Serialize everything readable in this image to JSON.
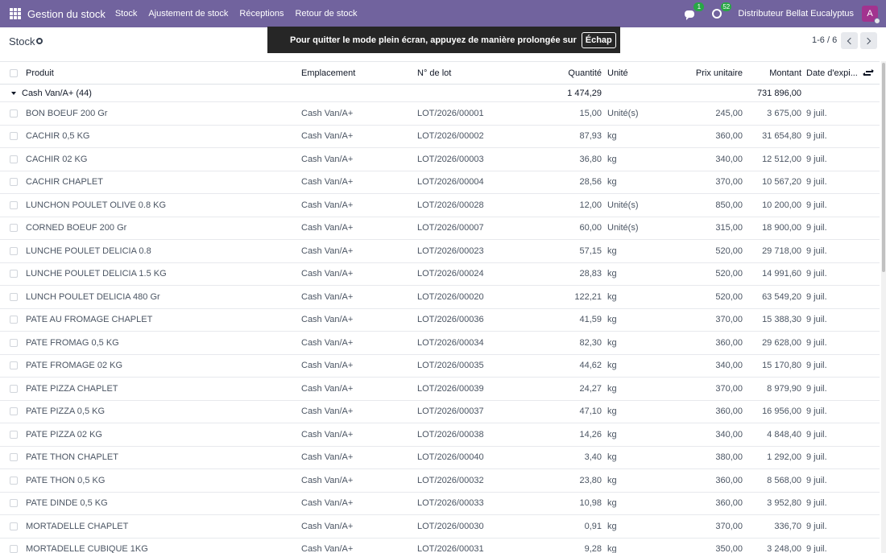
{
  "navbar": {
    "app_title": "Gestion du stock",
    "menu": [
      "Stock",
      "Ajustement de stock",
      "Réceptions",
      "Retour de stock"
    ],
    "messages_badge": "1",
    "activities_badge": "52",
    "company": "Distributeur Bellat Eucalyptus",
    "avatar_letter": "A",
    "colors": {
      "navbar_bg": "#71639e",
      "avatar_bg": "#a2338f",
      "badge_bg": "#28a745"
    }
  },
  "control_panel": {
    "breadcrumb": "Stock",
    "pager_value": "1-6 / 6"
  },
  "fullscreen_notice": {
    "text": "Pour quitter le mode plein écran, appuyez de manière prolongée sur",
    "key": "Échap"
  },
  "table": {
    "columns": {
      "product": "Produit",
      "location": "Emplacement",
      "lot": "N° de lot",
      "quantity": "Quantité",
      "uom": "Unité",
      "unit_price": "Prix unitaire",
      "amount": "Montant",
      "expiry": "Date d'expi..."
    },
    "group": {
      "label": "Cash Van/A+ (44)",
      "quantity": "1 474,29",
      "amount": "731 896,00"
    },
    "rows": [
      {
        "product": "BON BOEUF 200 Gr",
        "location": "Cash Van/A+",
        "lot": "LOT/2026/00001",
        "quantity": "15,00",
        "uom": "Unité(s)",
        "unit_price": "245,00",
        "amount": "3 675,00",
        "expiry": "9 juil."
      },
      {
        "product": "CACHIR 0,5 KG",
        "location": "Cash Van/A+",
        "lot": "LOT/2026/00002",
        "quantity": "87,93",
        "uom": "kg",
        "unit_price": "360,00",
        "amount": "31 654,80",
        "expiry": "9 juil."
      },
      {
        "product": "CACHIR 02 KG",
        "location": "Cash Van/A+",
        "lot": "LOT/2026/00003",
        "quantity": "36,80",
        "uom": "kg",
        "unit_price": "340,00",
        "amount": "12 512,00",
        "expiry": "9 juil."
      },
      {
        "product": "CACHIR CHAPLET",
        "location": "Cash Van/A+",
        "lot": "LOT/2026/00004",
        "quantity": "28,56",
        "uom": "kg",
        "unit_price": "370,00",
        "amount": "10 567,20",
        "expiry": "9 juil."
      },
      {
        "product": "LUNCHON POULET OLIVE 0.8 KG",
        "location": "Cash Van/A+",
        "lot": "LOT/2026/00028",
        "quantity": "12,00",
        "uom": "Unité(s)",
        "unit_price": "850,00",
        "amount": "10 200,00",
        "expiry": "9 juil."
      },
      {
        "product": "CORNED BOEUF 200 Gr",
        "location": "Cash Van/A+",
        "lot": "LOT/2026/00007",
        "quantity": "60,00",
        "uom": "Unité(s)",
        "unit_price": "315,00",
        "amount": "18 900,00",
        "expiry": "9 juil."
      },
      {
        "product": "LUNCHE POULET DELICIA 0.8",
        "location": "Cash Van/A+",
        "lot": "LOT/2026/00023",
        "quantity": "57,15",
        "uom": "kg",
        "unit_price": "520,00",
        "amount": "29 718,00",
        "expiry": "9 juil."
      },
      {
        "product": "LUNCHE POULET DELICIA 1.5 KG",
        "location": "Cash Van/A+",
        "lot": "LOT/2026/00024",
        "quantity": "28,83",
        "uom": "kg",
        "unit_price": "520,00",
        "amount": "14 991,60",
        "expiry": "9 juil."
      },
      {
        "product": "LUNCH POULET DELICIA 480 Gr",
        "location": "Cash Van/A+",
        "lot": "LOT/2026/00020",
        "quantity": "122,21",
        "uom": "kg",
        "unit_price": "520,00",
        "amount": "63 549,20",
        "expiry": "9 juil."
      },
      {
        "product": "PATE AU FROMAGE CHAPLET",
        "location": "Cash Van/A+",
        "lot": "LOT/2026/00036",
        "quantity": "41,59",
        "uom": "kg",
        "unit_price": "370,00",
        "amount": "15 388,30",
        "expiry": "9 juil."
      },
      {
        "product": "PATE FROMAG 0,5 KG",
        "location": "Cash Van/A+",
        "lot": "LOT/2026/00034",
        "quantity": "82,30",
        "uom": "kg",
        "unit_price": "360,00",
        "amount": "29 628,00",
        "expiry": "9 juil."
      },
      {
        "product": "PATE FROMAGE 02 KG",
        "location": "Cash Van/A+",
        "lot": "LOT/2026/00035",
        "quantity": "44,62",
        "uom": "kg",
        "unit_price": "340,00",
        "amount": "15 170,80",
        "expiry": "9 juil."
      },
      {
        "product": "PATE PIZZA CHAPLET",
        "location": "Cash Van/A+",
        "lot": "LOT/2026/00039",
        "quantity": "24,27",
        "uom": "kg",
        "unit_price": "370,00",
        "amount": "8 979,90",
        "expiry": "9 juil."
      },
      {
        "product": "PATE PIZZA 0,5 KG",
        "location": "Cash Van/A+",
        "lot": "LOT/2026/00037",
        "quantity": "47,10",
        "uom": "kg",
        "unit_price": "360,00",
        "amount": "16 956,00",
        "expiry": "9 juil."
      },
      {
        "product": "PATE PIZZA 02 KG",
        "location": "Cash Van/A+",
        "lot": "LOT/2026/00038",
        "quantity": "14,26",
        "uom": "kg",
        "unit_price": "340,00",
        "amount": "4 848,40",
        "expiry": "9 juil."
      },
      {
        "product": "PATE THON CHAPLET",
        "location": "Cash Van/A+",
        "lot": "LOT/2026/00040",
        "quantity": "3,40",
        "uom": "kg",
        "unit_price": "380,00",
        "amount": "1 292,00",
        "expiry": "9 juil."
      },
      {
        "product": "PATE THON 0,5 KG",
        "location": "Cash Van/A+",
        "lot": "LOT/2026/00032",
        "quantity": "23,80",
        "uom": "kg",
        "unit_price": "360,00",
        "amount": "8 568,00",
        "expiry": "9 juil."
      },
      {
        "product": "PATE DINDE 0,5 KG",
        "location": "Cash Van/A+",
        "lot": "LOT/2026/00033",
        "quantity": "10,98",
        "uom": "kg",
        "unit_price": "360,00",
        "amount": "3 952,80",
        "expiry": "9 juil."
      },
      {
        "product": "MORTADELLE CHAPLET",
        "location": "Cash Van/A+",
        "lot": "LOT/2026/00030",
        "quantity": "0,91",
        "uom": "kg",
        "unit_price": "370,00",
        "amount": "336,70",
        "expiry": "9 juil."
      },
      {
        "product": "MORTADELLE CUBIQUE 1KG",
        "location": "Cash Van/A+",
        "lot": "LOT/2026/00031",
        "quantity": "9,28",
        "uom": "kg",
        "unit_price": "350,00",
        "amount": "3 248,00",
        "expiry": "9 juil."
      }
    ]
  }
}
